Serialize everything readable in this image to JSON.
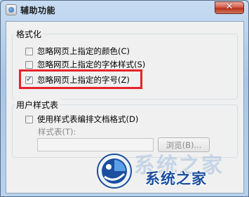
{
  "window": {
    "title": "辅助功能",
    "close_symbol": "✕"
  },
  "formatting": {
    "legend": "格式化",
    "options": [
      {
        "label": "忽略网页上指定的颜色(C)",
        "checked": false
      },
      {
        "label": "忽略网页上指定的字体样式(S)",
        "checked": false
      },
      {
        "label": "忽略网页上指定的字号(Z)",
        "checked": true
      }
    ]
  },
  "user_stylesheet": {
    "legend": "用户样式表",
    "option": {
      "label": "使用样式表编排文档格式(D)",
      "checked": false
    },
    "stylesheet_label": "样式表(T):",
    "path_value": "",
    "browse_label": "浏览(B)..."
  },
  "watermark": {
    "shadow_text": "系统之家",
    "text": "系统之家",
    "logo": "globe-logo"
  },
  "colors": {
    "highlight": "#e8222a",
    "watermark_text": "#1c4fa0"
  }
}
